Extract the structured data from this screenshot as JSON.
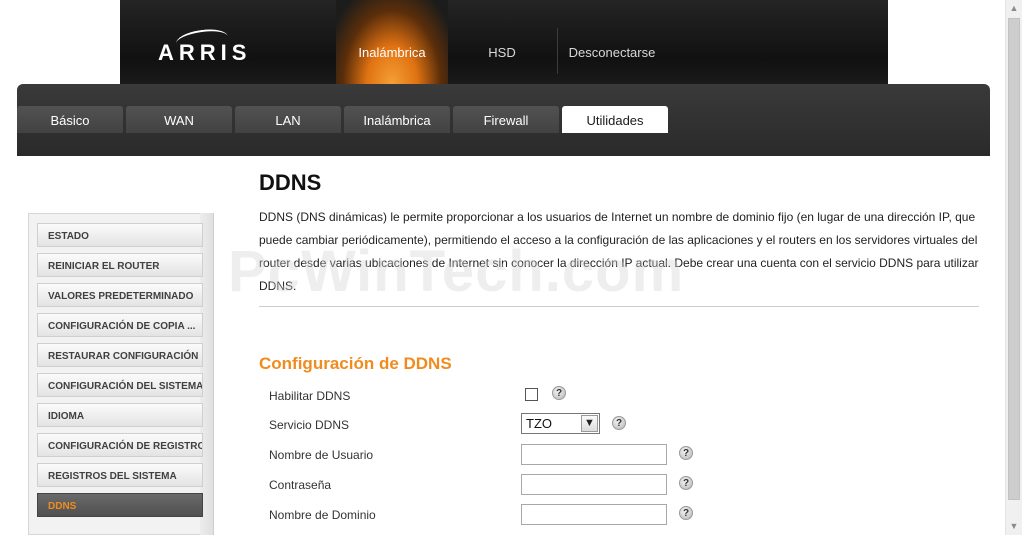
{
  "header": {
    "logo": "ARRIS",
    "top_nav": [
      "Inalámbrica",
      "HSD",
      "Desconectarse"
    ],
    "active_top_nav": "Inalámbrica"
  },
  "tabs": [
    "Básico",
    "WAN",
    "LAN",
    "Inalámbrica",
    "Firewall",
    "Utilidades"
  ],
  "active_tab": "Utilidades",
  "sidebar": {
    "items": [
      "ESTADO",
      "REINICIAR EL ROUTER",
      "VALORES PREDETERMINADO",
      "CONFIGURACIÓN DE COPIA ...",
      "RESTAURAR CONFIGURACIÓN",
      "CONFIGURACIÓN DEL SISTEMA",
      "IDIOMA",
      "CONFIGURACIÓN DE REGISTRO",
      "REGISTROS DEL SISTEMA",
      "DDNS"
    ],
    "active_item": "DDNS"
  },
  "main": {
    "title": "DDNS",
    "description": "DDNS (DNS dinámicas) le permite proporcionar a los usuarios de Internet un nombre de dominio fijo (en lugar de una dirección IP, que puede cambiar periódicamente), permitiendo el acceso a la configuración de las aplicaciones y el routers en los servidores virtuales del router desde varias ubicaciones de Internet sin conocer la dirección IP actual. Debe crear una cuenta con el servicio DDNS para utilizar DDNS.",
    "section_title": "Configuración de DDNS",
    "fields": {
      "enable_ddns": {
        "label": "Habilitar DDNS",
        "checked": false
      },
      "ddns_service": {
        "label": "Servicio DDNS",
        "value": "TZO"
      },
      "username": {
        "label": "Nombre de Usuario",
        "value": ""
      },
      "password": {
        "label": "Contraseña",
        "value": ""
      },
      "domain": {
        "label": "Nombre de Dominio",
        "value": ""
      }
    },
    "help_symbol": "?"
  },
  "watermark": "PcWinTech.com",
  "icons": {
    "help": "question-mark-icon",
    "dropdown": "chevron-down-icon",
    "scroll_up": "arrow-up-icon",
    "scroll_down": "arrow-down-icon"
  },
  "colors": {
    "accent": "#f08c1e",
    "header_bg": "#1a1a1a",
    "tabbar_bg": "#333333"
  }
}
